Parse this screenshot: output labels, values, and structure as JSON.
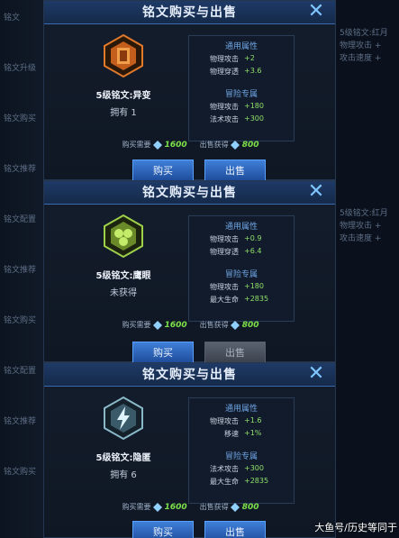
{
  "background": {
    "left_rows": [
      "铭文",
      "铭文升级",
      "铭文购买",
      "铭文推荐",
      "铭文配置",
      "铭文推荐",
      "铭文购买",
      "铭文配置",
      "铭文推荐",
      "铭文购买"
    ],
    "right_rows": [
      "5级铭文:红月",
      "物理攻击 +",
      "攻击速度 +",
      "5级铭文:红月",
      "物理攻击 +",
      "攻击速度 +"
    ]
  },
  "panels": [
    {
      "title": "铭文购买与出售",
      "rune_name": "5级铭文:异变",
      "owned": "拥有 1",
      "general_title": "通用属性",
      "general": [
        {
          "label": "物理攻击",
          "value": "+2"
        },
        {
          "label": "物理穿透",
          "value": "+3.6"
        }
      ],
      "adventure_title": "冒险专属",
      "adventure": [
        {
          "label": "物理攻击",
          "value": "+180"
        },
        {
          "label": "法术攻击",
          "value": "+300"
        }
      ],
      "buy_cost_label": "购买需要",
      "buy_cost": "1600",
      "sell_gain_label": "出售获得",
      "sell_gain": "800",
      "buy_label": "购买",
      "sell_label": "出售",
      "sell_enabled": true,
      "rune_color": "#e07a2a"
    },
    {
      "title": "铭文购买与出售",
      "rune_name": "5级铭文:鹰眼",
      "owned": "未获得",
      "general_title": "通用属性",
      "general": [
        {
          "label": "物理攻击",
          "value": "+0.9"
        },
        {
          "label": "物理穿透",
          "value": "+6.4"
        }
      ],
      "adventure_title": "冒险专属",
      "adventure": [
        {
          "label": "物理攻击",
          "value": "+180"
        },
        {
          "label": "最大生命",
          "value": "+2835"
        }
      ],
      "buy_cost_label": "购买需要",
      "buy_cost": "1600",
      "sell_gain_label": "出售获得",
      "sell_gain": "800",
      "buy_label": "购买",
      "sell_label": "出售",
      "sell_enabled": false,
      "rune_color": "#9ed04a"
    },
    {
      "title": "铭文购买与出售",
      "rune_name": "5级铭文:隐匿",
      "owned": "拥有 6",
      "general_title": "通用属性",
      "general": [
        {
          "label": "物理攻击",
          "value": "+1.6"
        },
        {
          "label": "移速",
          "value": "+1%"
        }
      ],
      "adventure_title": "冒险专属",
      "adventure": [
        {
          "label": "法术攻击",
          "value": "+300"
        },
        {
          "label": "最大生命",
          "value": "+2835"
        }
      ],
      "buy_cost_label": "购买需要",
      "buy_cost": "1600",
      "sell_gain_label": "出售获得",
      "sell_gain": "800",
      "buy_label": "购买",
      "sell_label": "出售",
      "sell_enabled": true,
      "rune_color": "#8ab8c8"
    }
  ],
  "watermark": "大鱼号/历史等同于"
}
